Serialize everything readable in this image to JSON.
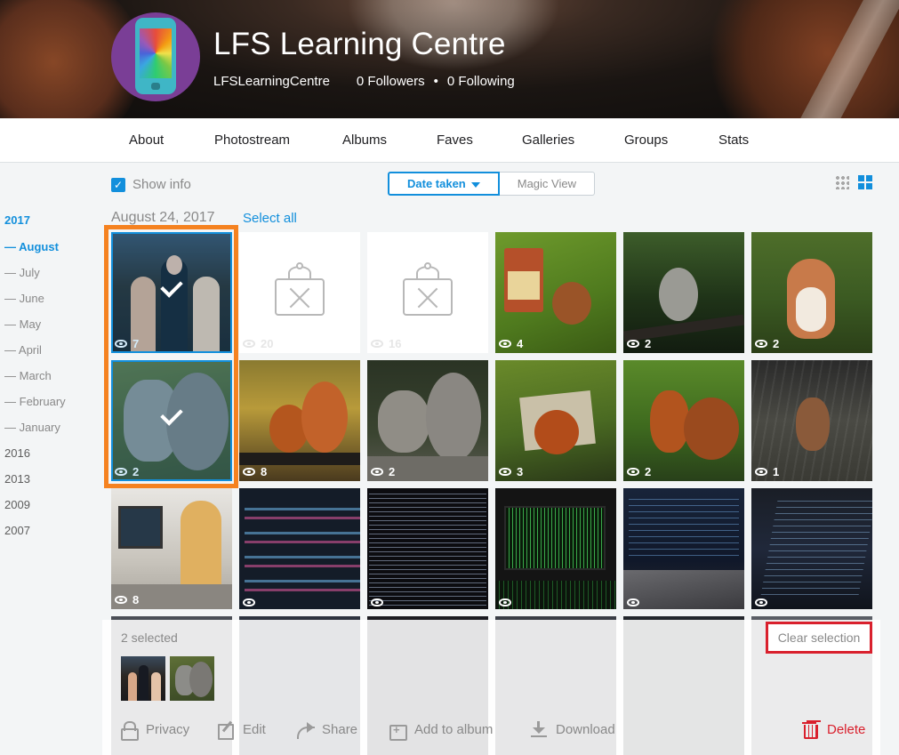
{
  "profile": {
    "name": "LFS Learning Centre",
    "username": "LFSLearningCentre",
    "followers": "0 Followers",
    "separator": "•",
    "following": "0 Following"
  },
  "nav": {
    "items": [
      "About",
      "Photostream",
      "Albums",
      "Faves",
      "Galleries",
      "Groups",
      "Stats"
    ]
  },
  "toolbar": {
    "show_info_label": "Show info",
    "show_info_checked": true,
    "sort_label": "Date taken",
    "magic_view_label": "Magic View",
    "grid_view_icon": "small-grid-icon",
    "large_view_icon": "large-grid-icon",
    "accent_color": "#128fdc"
  },
  "timeline": {
    "years_top": "2017",
    "months": [
      "August",
      "July",
      "June",
      "May",
      "April",
      "March",
      "February",
      "January"
    ],
    "months_prefix": "— ",
    "active_month": "August",
    "other_years": [
      "2016",
      "2013",
      "2009",
      "2007"
    ]
  },
  "section": {
    "date": "August 24, 2017",
    "select_all": "Select all"
  },
  "photos": [
    {
      "views": "7",
      "state": "selected",
      "subject": "people-at-event"
    },
    {
      "views": "20",
      "state": "placeholder"
    },
    {
      "views": "16",
      "state": "placeholder"
    },
    {
      "views": "4",
      "subject": "squirrel-feeder"
    },
    {
      "views": "2",
      "subject": "squirrel-branch"
    },
    {
      "views": "2",
      "subject": "squirrel-standing"
    },
    {
      "views": "2",
      "state": "selected",
      "subject": "grey-squirrel"
    },
    {
      "views": "8",
      "subject": "red-squirrel-fence"
    },
    {
      "views": "2",
      "subject": "grey-squirrel-rock"
    },
    {
      "views": "3",
      "subject": "red-squirrel-birdhouse"
    },
    {
      "views": "2",
      "subject": "red-squirrel-moss"
    },
    {
      "views": "1",
      "subject": "squirrel-tree"
    },
    {
      "views": "8",
      "subject": "woman-at-computer"
    },
    {
      "views": "",
      "subject": "code-closeup"
    },
    {
      "views": "",
      "subject": "code-dense"
    },
    {
      "views": "",
      "subject": "matrix-screen"
    },
    {
      "views": "",
      "subject": "laptop-code"
    },
    {
      "views": "",
      "subject": "monitor-code"
    }
  ],
  "batch": {
    "count": "2 selected",
    "clear": "Clear selection",
    "actions": {
      "privacy": "Privacy",
      "edit": "Edit",
      "share": "Share",
      "album": "Add to album",
      "download": "Download",
      "delete": "Delete"
    },
    "delete_color": "#d9202d"
  }
}
